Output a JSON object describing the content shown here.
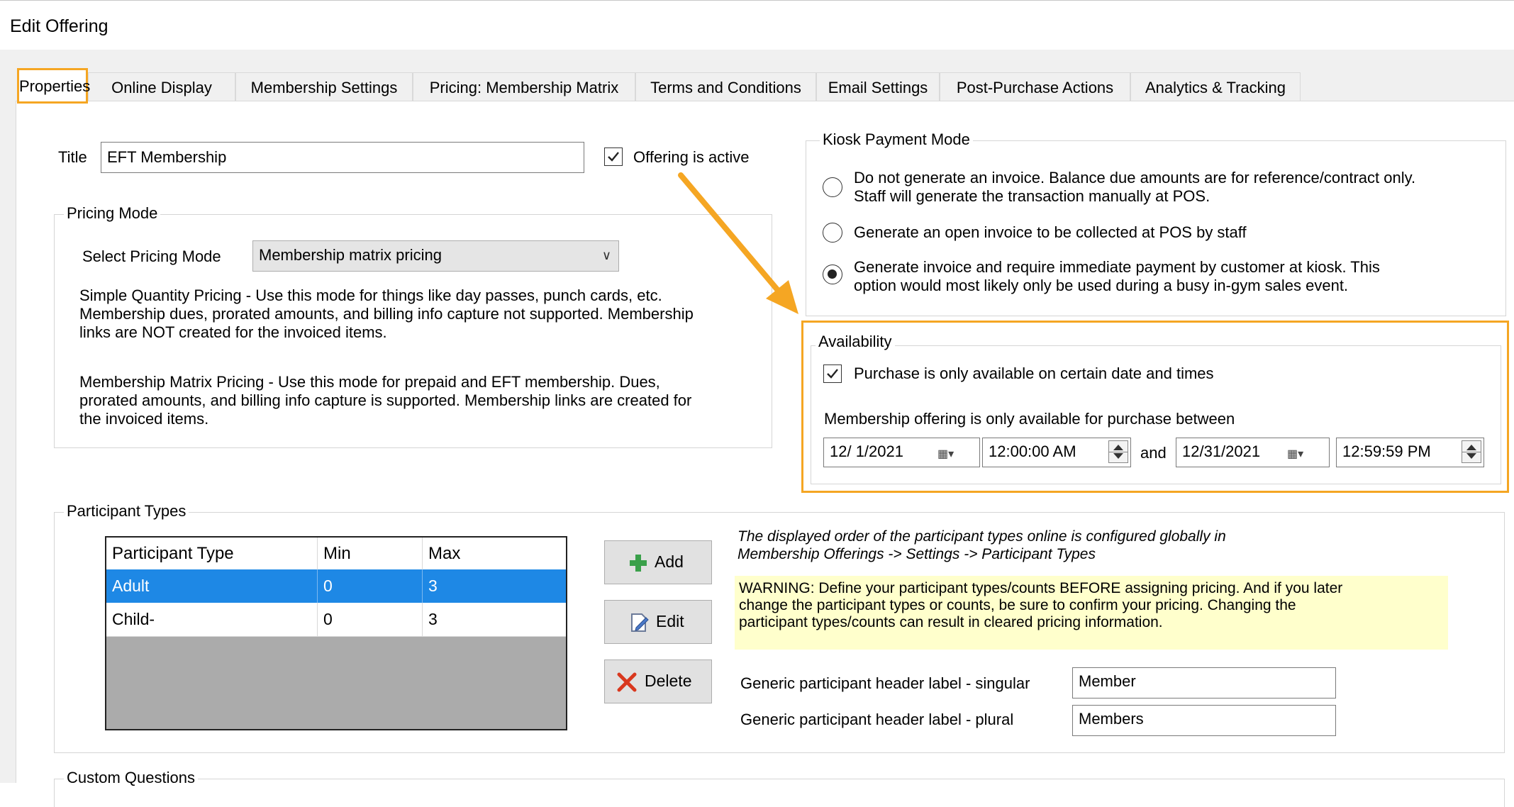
{
  "window": {
    "title": "Edit Offering"
  },
  "tabs": [
    {
      "label": "Properties",
      "active": true
    },
    {
      "label": "Online Display"
    },
    {
      "label": "Membership Settings"
    },
    {
      "label": "Pricing: Membership Matrix"
    },
    {
      "label": "Terms and Conditions"
    },
    {
      "label": "Email Settings"
    },
    {
      "label": "Post-Purchase Actions"
    },
    {
      "label": "Analytics & Tracking"
    }
  ],
  "title_field": {
    "label": "Title",
    "value": "EFT Membership"
  },
  "offering_active": {
    "label": "Offering is active",
    "checked": true
  },
  "pricing_mode": {
    "legend": "Pricing Mode",
    "select_label": "Select Pricing Mode",
    "selected": "Membership matrix pricing",
    "desc_simple": "Simple Quantity Pricing - Use this mode for things like day passes, punch cards, etc.\nMembership dues, prorated amounts, and billing info capture not supported.  Membership\nlinks are NOT created for the invoiced items.",
    "desc_matrix": "Membership Matrix Pricing - Use this mode for prepaid and EFT membership.   Dues,\nprorated amounts, and billing info capture is supported.  Membership links are created for\nthe invoiced items."
  },
  "kiosk": {
    "legend": "Kiosk Payment Mode",
    "options": [
      {
        "label": "Do not generate an invoice.  Balance due amounts are for reference/contract only.\nStaff will generate the transaction manually at POS.",
        "selected": false
      },
      {
        "label": "Generate an open invoice to be collected at POS by staff",
        "selected": false
      },
      {
        "label": "Generate invoice and require immediate payment by customer at kiosk.  This\noption would most likely only be used during a busy in-gym sales event.",
        "selected": true
      }
    ]
  },
  "availability": {
    "legend": "Availability",
    "checkbox_label": "Purchase is only available on certain date and times",
    "checked": true,
    "between_label": "Membership offering is only available for purchase between",
    "start_date": "12/  1/2021",
    "start_time": "12:00:00 AM",
    "and_label": "and",
    "end_date": "12/31/2021",
    "end_time": "12:59:59 PM"
  },
  "participant_types": {
    "legend": "Participant Types",
    "columns": [
      "Participant Type",
      "Min",
      "Max"
    ],
    "rows": [
      {
        "type": "Adult",
        "min": "0",
        "max": "3",
        "selected": true
      },
      {
        "type": "Child-",
        "min": "0",
        "max": "3",
        "selected": false
      }
    ],
    "add_label": "Add",
    "edit_label": "Edit",
    "delete_label": "Delete",
    "order_note": "The displayed order of the participant types online is configured globally in\nMembership Offerings -> Settings -> Participant Types",
    "warning": "WARNING:  Define your participant types/counts BEFORE assigning pricing.  And if you later\nchange the participant types or counts, be sure to confirm your pricing.  Changing the\nparticipant types/counts can result in cleared pricing information.",
    "singular_label": "Generic participant header label - singular",
    "singular_value": "Member",
    "plural_label": "Generic participant header label - plural",
    "plural_value": "Members"
  },
  "custom_questions": {
    "legend": "Custom Questions"
  },
  "colors": {
    "highlight": "#f5a623",
    "selection": "#1e88e5",
    "warning_bg": "#ffffcc"
  }
}
